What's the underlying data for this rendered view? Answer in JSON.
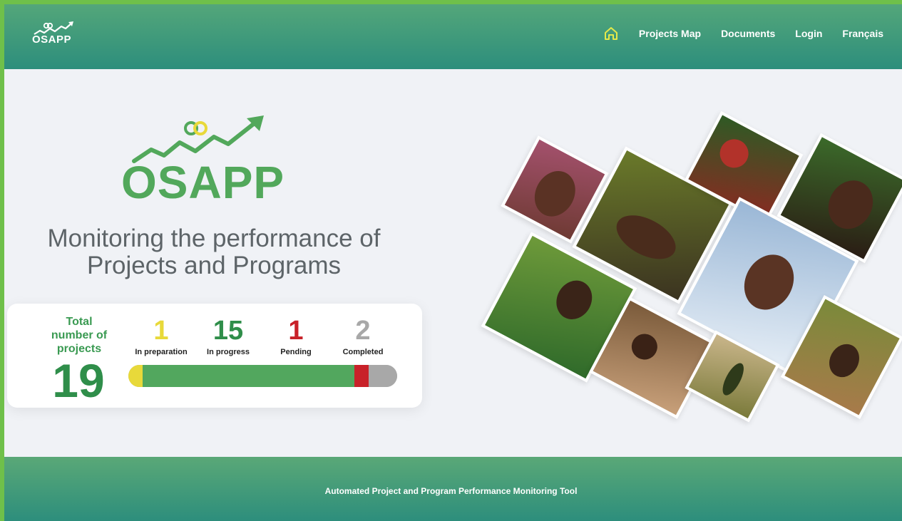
{
  "header": {
    "brand": "OSAPP",
    "nav": [
      {
        "label": "Projects Map"
      },
      {
        "label": "Documents"
      },
      {
        "label": "Login"
      },
      {
        "label": "Français"
      }
    ]
  },
  "hero": {
    "logo_text": "OSAPP",
    "tagline_line1": "Monitoring the performance of",
    "tagline_line2": "Projects and Programs"
  },
  "stats": {
    "total_label_line1": "Total",
    "total_label_line2": "number of",
    "total_label_line3": "projects",
    "total_value": "19",
    "items": [
      {
        "value": "1",
        "label": "In preparation",
        "color": "#e8d93a",
        "count": 1
      },
      {
        "value": "15",
        "label": "In progress",
        "color": "#52a75e",
        "count": 15
      },
      {
        "value": "1",
        "label": "Pending",
        "color": "#c82129",
        "count": 1
      },
      {
        "value": "2",
        "label": "Completed",
        "color": "#a8a8a8",
        "count": 2
      }
    ]
  },
  "footer": {
    "text": "Automated Project and Program Performance Monitoring Tool"
  },
  "colors": {
    "brand_green": "#52a85b",
    "header_top": "#56a87a",
    "header_bottom": "#2d8e7c",
    "frame": "#6fc04a"
  }
}
